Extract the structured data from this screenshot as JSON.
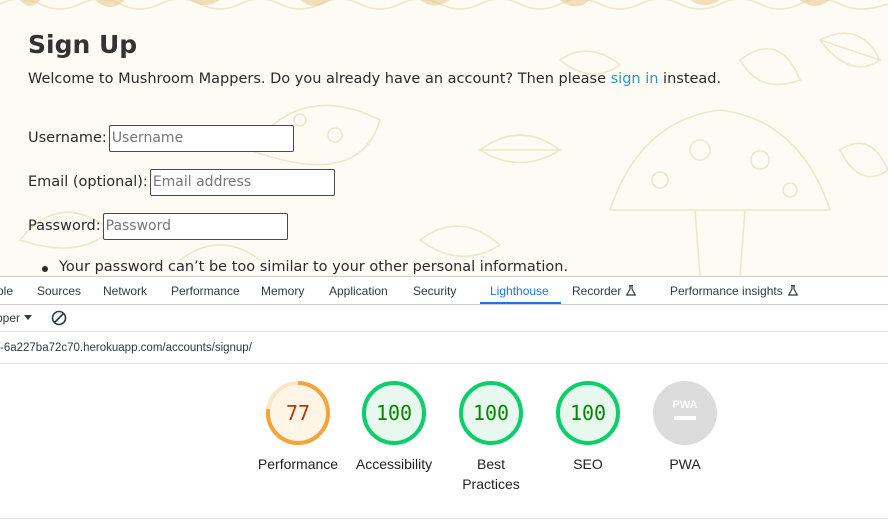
{
  "page": {
    "title": "Sign Up",
    "welcome_before": "Welcome to Mushroom Mappers. Do you already have an account? Then please ",
    "signin_link": "sign in",
    "welcome_after": " instead.",
    "username_label": "Username:",
    "username_placeholder": "Username",
    "email_label": "Email (optional):",
    "email_placeholder": "Email address",
    "password_label": "Password:",
    "password_placeholder": "Password",
    "password_help": "Your password can’t be too similar to your other personal information.",
    "accent_color": "#2a9bb6"
  },
  "devtools": {
    "tabs": [
      {
        "label": "ole"
      },
      {
        "label": "Sources"
      },
      {
        "label": "Network"
      },
      {
        "label": "Performance"
      },
      {
        "label": "Memory"
      },
      {
        "label": "Application"
      },
      {
        "label": "Security"
      },
      {
        "label": "Lighthouse",
        "active": true
      },
      {
        "label": "Recorder",
        "icon": "flask-icon"
      },
      {
        "label": "Performance insights",
        "icon": "flask-icon"
      }
    ],
    "toolbar": {
      "mode_label": "pper",
      "clear_icon": "clear-icon"
    },
    "url": "-6a227ba72c70.herokuapp.com/accounts/signup/",
    "scores": [
      {
        "score": "77",
        "label": "Performance",
        "value": 0.77,
        "status": "average",
        "color": "#e67700",
        "ring": "#f5a43a",
        "fill": "#fff6e8"
      },
      {
        "score": "100",
        "label": "Accessibility",
        "value": 1.0,
        "status": "pass",
        "color": "#008800",
        "ring": "#0cce6b",
        "fill": "#e8f8ee"
      },
      {
        "score": "100",
        "label": "Best Practices",
        "value": 1.0,
        "status": "pass",
        "color": "#008800",
        "ring": "#0cce6b",
        "fill": "#e8f8ee"
      },
      {
        "score": "100",
        "label": "SEO",
        "value": 1.0,
        "status": "pass",
        "color": "#008800",
        "ring": "#0cce6b",
        "fill": "#e8f8ee"
      },
      {
        "score": "PWA",
        "label": "PWA",
        "value": 0,
        "status": "na",
        "color": "#ffffff",
        "ring": "#dcdcdc",
        "fill": "#dcdcdc"
      }
    ]
  }
}
